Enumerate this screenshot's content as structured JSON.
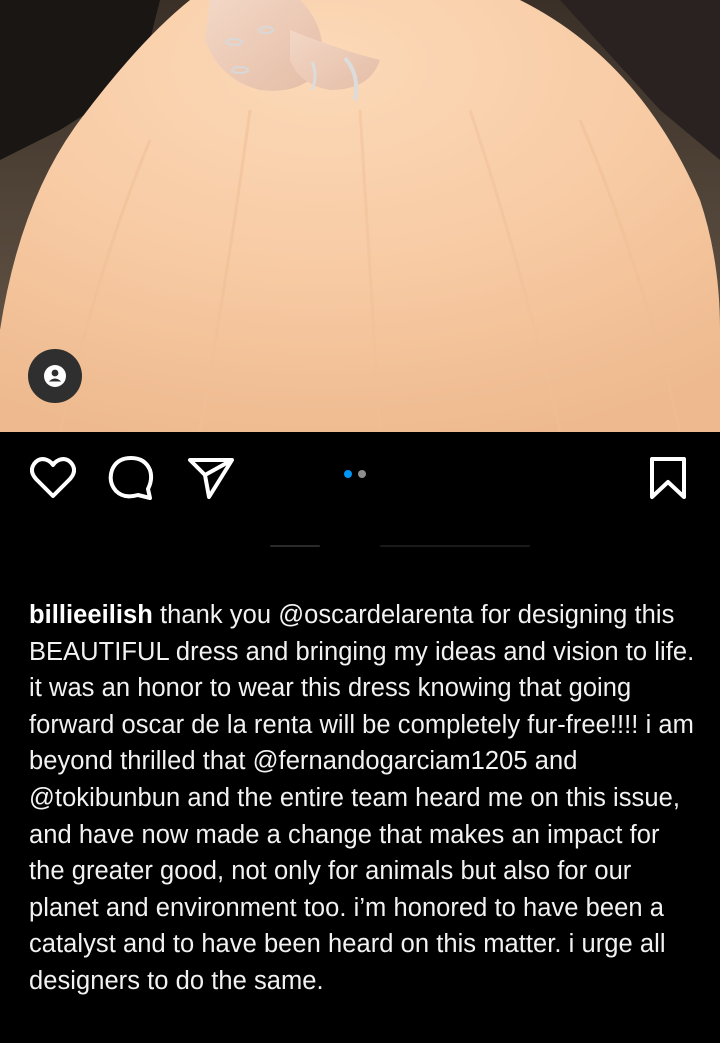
{
  "post": {
    "tag_icon": "user-tag-icon",
    "carousel": {
      "total": 2,
      "active_index": 0,
      "active_color": "#0095f6",
      "inactive_color": "#8e8e8e"
    }
  },
  "actions": {
    "like_icon": "heart-icon",
    "comment_icon": "comment-icon",
    "share_icon": "send-icon",
    "save_icon": "bookmark-icon"
  },
  "caption": {
    "username": "billieeilish",
    "parts": [
      {
        "text": " thank you ",
        "type": "text"
      },
      {
        "text": "@oscardelarenta",
        "type": "mention"
      },
      {
        "text": " for designing this BEAUTIFUL dress and bringing my ideas and vision to life. it was an honor to wear this dress knowing that going forward oscar de la renta will be completely fur-free!!!! i am beyond thrilled that ",
        "type": "text"
      },
      {
        "text": "@fernandogarciam1205",
        "type": "mention"
      },
      {
        "text": " and ",
        "type": "text"
      },
      {
        "text": "@tokibunbun",
        "type": "mention"
      },
      {
        "text": " and the entire team heard me on this issue, and have now made a change that makes an impact for the greater good, not only for animals but also for our planet and environment too. i’m honored to have been a catalyst and to have been heard on this matter. i urge all designers to do the same.",
        "type": "text"
      }
    ]
  }
}
